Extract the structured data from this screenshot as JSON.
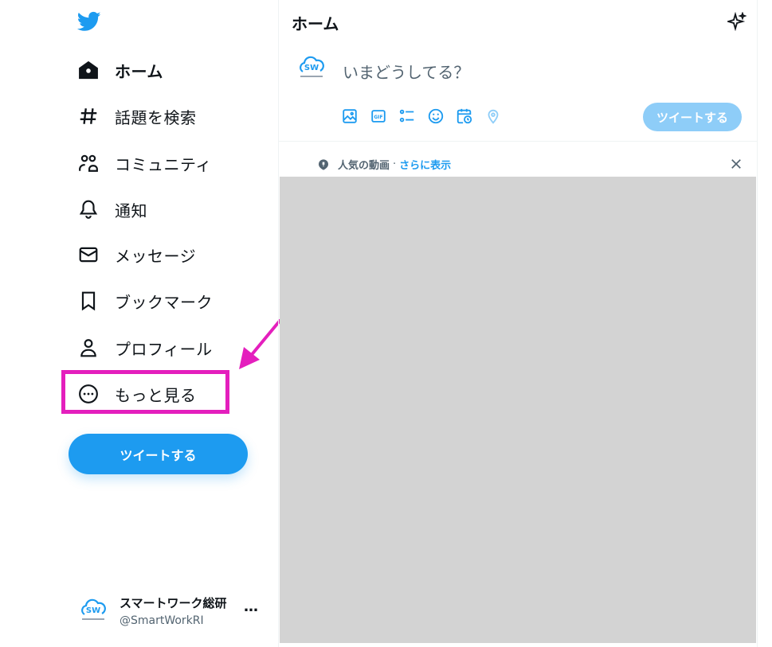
{
  "sidebar": {
    "items": [
      {
        "label": "ホーム",
        "icon": "home-icon"
      },
      {
        "label": "話題を検索",
        "icon": "hashtag-icon"
      },
      {
        "label": "コミュニティ",
        "icon": "communities-icon"
      },
      {
        "label": "通知",
        "icon": "bell-icon"
      },
      {
        "label": "メッセージ",
        "icon": "envelope-icon"
      },
      {
        "label": "ブックマーク",
        "icon": "bookmark-icon"
      },
      {
        "label": "プロフィール",
        "icon": "person-icon"
      },
      {
        "label": "もっと見る",
        "icon": "more-circle-icon"
      }
    ],
    "tweet_button": "ツイートする"
  },
  "account": {
    "name": "スマートワーク総研",
    "handle": "@SmartWorkRI",
    "more": "…"
  },
  "main": {
    "title": "ホーム",
    "composer": {
      "placeholder": "いまどうしてる？",
      "tweet_button": "ツイートする"
    },
    "topic": {
      "label": "人気の動画",
      "separator": "·",
      "link": "さらに表示"
    }
  },
  "colors": {
    "brand": "#1d9bf0",
    "disabled_button": "#8ecdf8",
    "highlight": "#e41fbd",
    "placeholder_block": "#d3d3d3"
  }
}
